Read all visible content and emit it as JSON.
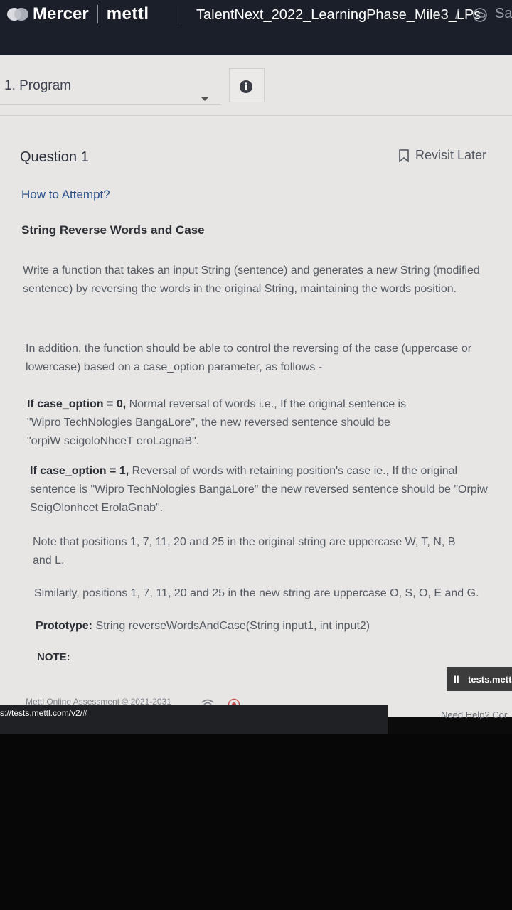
{
  "header": {
    "brand": "Mercer",
    "brand2": "mettl",
    "test_title": "TalentNext_2022_LearningPhase_Mile3_LPs",
    "crumb_slash": "/",
    "crumb_tail": "Sa"
  },
  "question_select": {
    "label": "1. Program"
  },
  "question": {
    "title": "Question 1",
    "revisit_label": "Revisit Later",
    "how_to": "How to Attempt?",
    "problem_title": "String Reverse Words and Case",
    "p1": "Write a function that takes an input String (sentence) and generates a new String (modified sentence) by reversing the words in the original String, maintaining the words position.",
    "p2": "In addition, the function should be able to control the reversing of the case (uppercase or lowercase) based on a case_option parameter, as follows -",
    "p3_bold": "If case_option = 0,",
    "p3_rest": " Normal reversal of words i.e., If the original sentence is \"Wipro TechNologies BangaLore\", the new reversed sentence should be \"orpiW seigoloNhceT eroLagnaB\".",
    "p4_bold": "If case_option = 1,",
    "p4_rest": " Reversal of words with retaining position's case ie., If the original sentence is \"Wipro TechNologies BangaLore\" the new reversed sentence should be \"Orpiw SeigOlonhcet ErolaGnab\".",
    "p5": "Note that positions 1, 7, 11, 20 and 25 in the original string are uppercase W, T, N, B and L.",
    "p6": "Similarly, positions 1, 7, 11, 20 and 25 in the new string are uppercase O, S, O, E and G.",
    "p7_bold": "Prototype:",
    "p7_rest": " String reverseWordsAndCase(String input1, int input2)",
    "p8": "NOTE:"
  },
  "badge": {
    "pause": "II",
    "text": "tests.mett"
  },
  "footer": {
    "copyright": "Mettl Online Assessment © 2021-2031",
    "url": "s://tests.mettl.com/v2/#",
    "need_help": "Need Help? Cor"
  },
  "colors": {
    "header_bg": "#1a1f2a",
    "page_bg": "#e7e6e4",
    "link": "#2a4f8a"
  }
}
